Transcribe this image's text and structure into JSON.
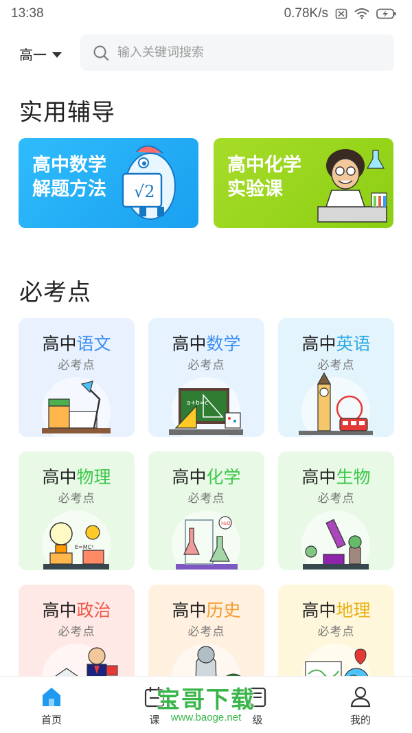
{
  "status_bar": {
    "time": "13:38",
    "network_speed": "0.78K/s"
  },
  "header": {
    "grade": "高一",
    "search_placeholder": "输入关键词搜索"
  },
  "tutoring": {
    "title": "实用辅导",
    "banners": [
      {
        "line1": "高中数学",
        "line2": "解题方法",
        "color_start": "#2fbcfb",
        "color_end": "#1aa0f0"
      },
      {
        "line1": "高中化学",
        "line2": "实验课",
        "color_start": "#a6dc28",
        "color_end": "#8ccf14"
      }
    ]
  },
  "key_points": {
    "title": "必考点",
    "cards": [
      {
        "prefix": "高中",
        "subject": "语文",
        "subtitle": "必考点",
        "accent": "#3b8df2",
        "bg": "#e9f1ff",
        "icon": "desk-lamp-books-icon"
      },
      {
        "prefix": "高中",
        "subject": "数学",
        "subtitle": "必考点",
        "accent": "#3b8df2",
        "bg": "#e6f3ff",
        "icon": "chalkboard-ruler-icon"
      },
      {
        "prefix": "高中",
        "subject": "英语",
        "subtitle": "必考点",
        "accent": "#2aa9e6",
        "bg": "#e4f4fc",
        "icon": "big-ben-bus-icon"
      },
      {
        "prefix": "高中",
        "subject": "物理",
        "subtitle": "必考点",
        "accent": "#3cc84a",
        "bg": "#e8f9e6",
        "icon": "lightbulb-gears-icon"
      },
      {
        "prefix": "高中",
        "subject": "化学",
        "subtitle": "必考点",
        "accent": "#3cc84a",
        "bg": "#e8f9e6",
        "icon": "lab-flasks-icon"
      },
      {
        "prefix": "高中",
        "subject": "生物",
        "subtitle": "必考点",
        "accent": "#3cc84a",
        "bg": "#e8f9e6",
        "icon": "microscope-plant-icon"
      },
      {
        "prefix": "高中",
        "subject": "政治",
        "subtitle": "必考点",
        "accent": "#f05a4a",
        "bg": "#ffe9e6",
        "icon": "speaker-building-icon"
      },
      {
        "prefix": "高中",
        "subject": "历史",
        "subtitle": "必考点",
        "accent": "#f39a2c",
        "bg": "#fff0e0",
        "icon": "statue-pine-icon"
      },
      {
        "prefix": "高中",
        "subject": "地理",
        "subtitle": "必考点",
        "accent": "#e8b012",
        "bg": "#fff7dc",
        "icon": "globe-map-icon"
      }
    ]
  },
  "bottom_nav": {
    "items": [
      {
        "label": "首页",
        "icon": "home-icon",
        "active": true
      },
      {
        "label": "课",
        "icon": "course-calendar-icon",
        "active": false
      },
      {
        "label": "级",
        "icon": "grade-book-icon",
        "active": false
      },
      {
        "label": "我的",
        "icon": "profile-icon",
        "active": false
      }
    ]
  },
  "watermark": {
    "brand": "宝哥下载",
    "url": "www.baoge.net"
  },
  "colors": {
    "nav_active": "#1e9bf0",
    "text_primary": "#222222"
  }
}
